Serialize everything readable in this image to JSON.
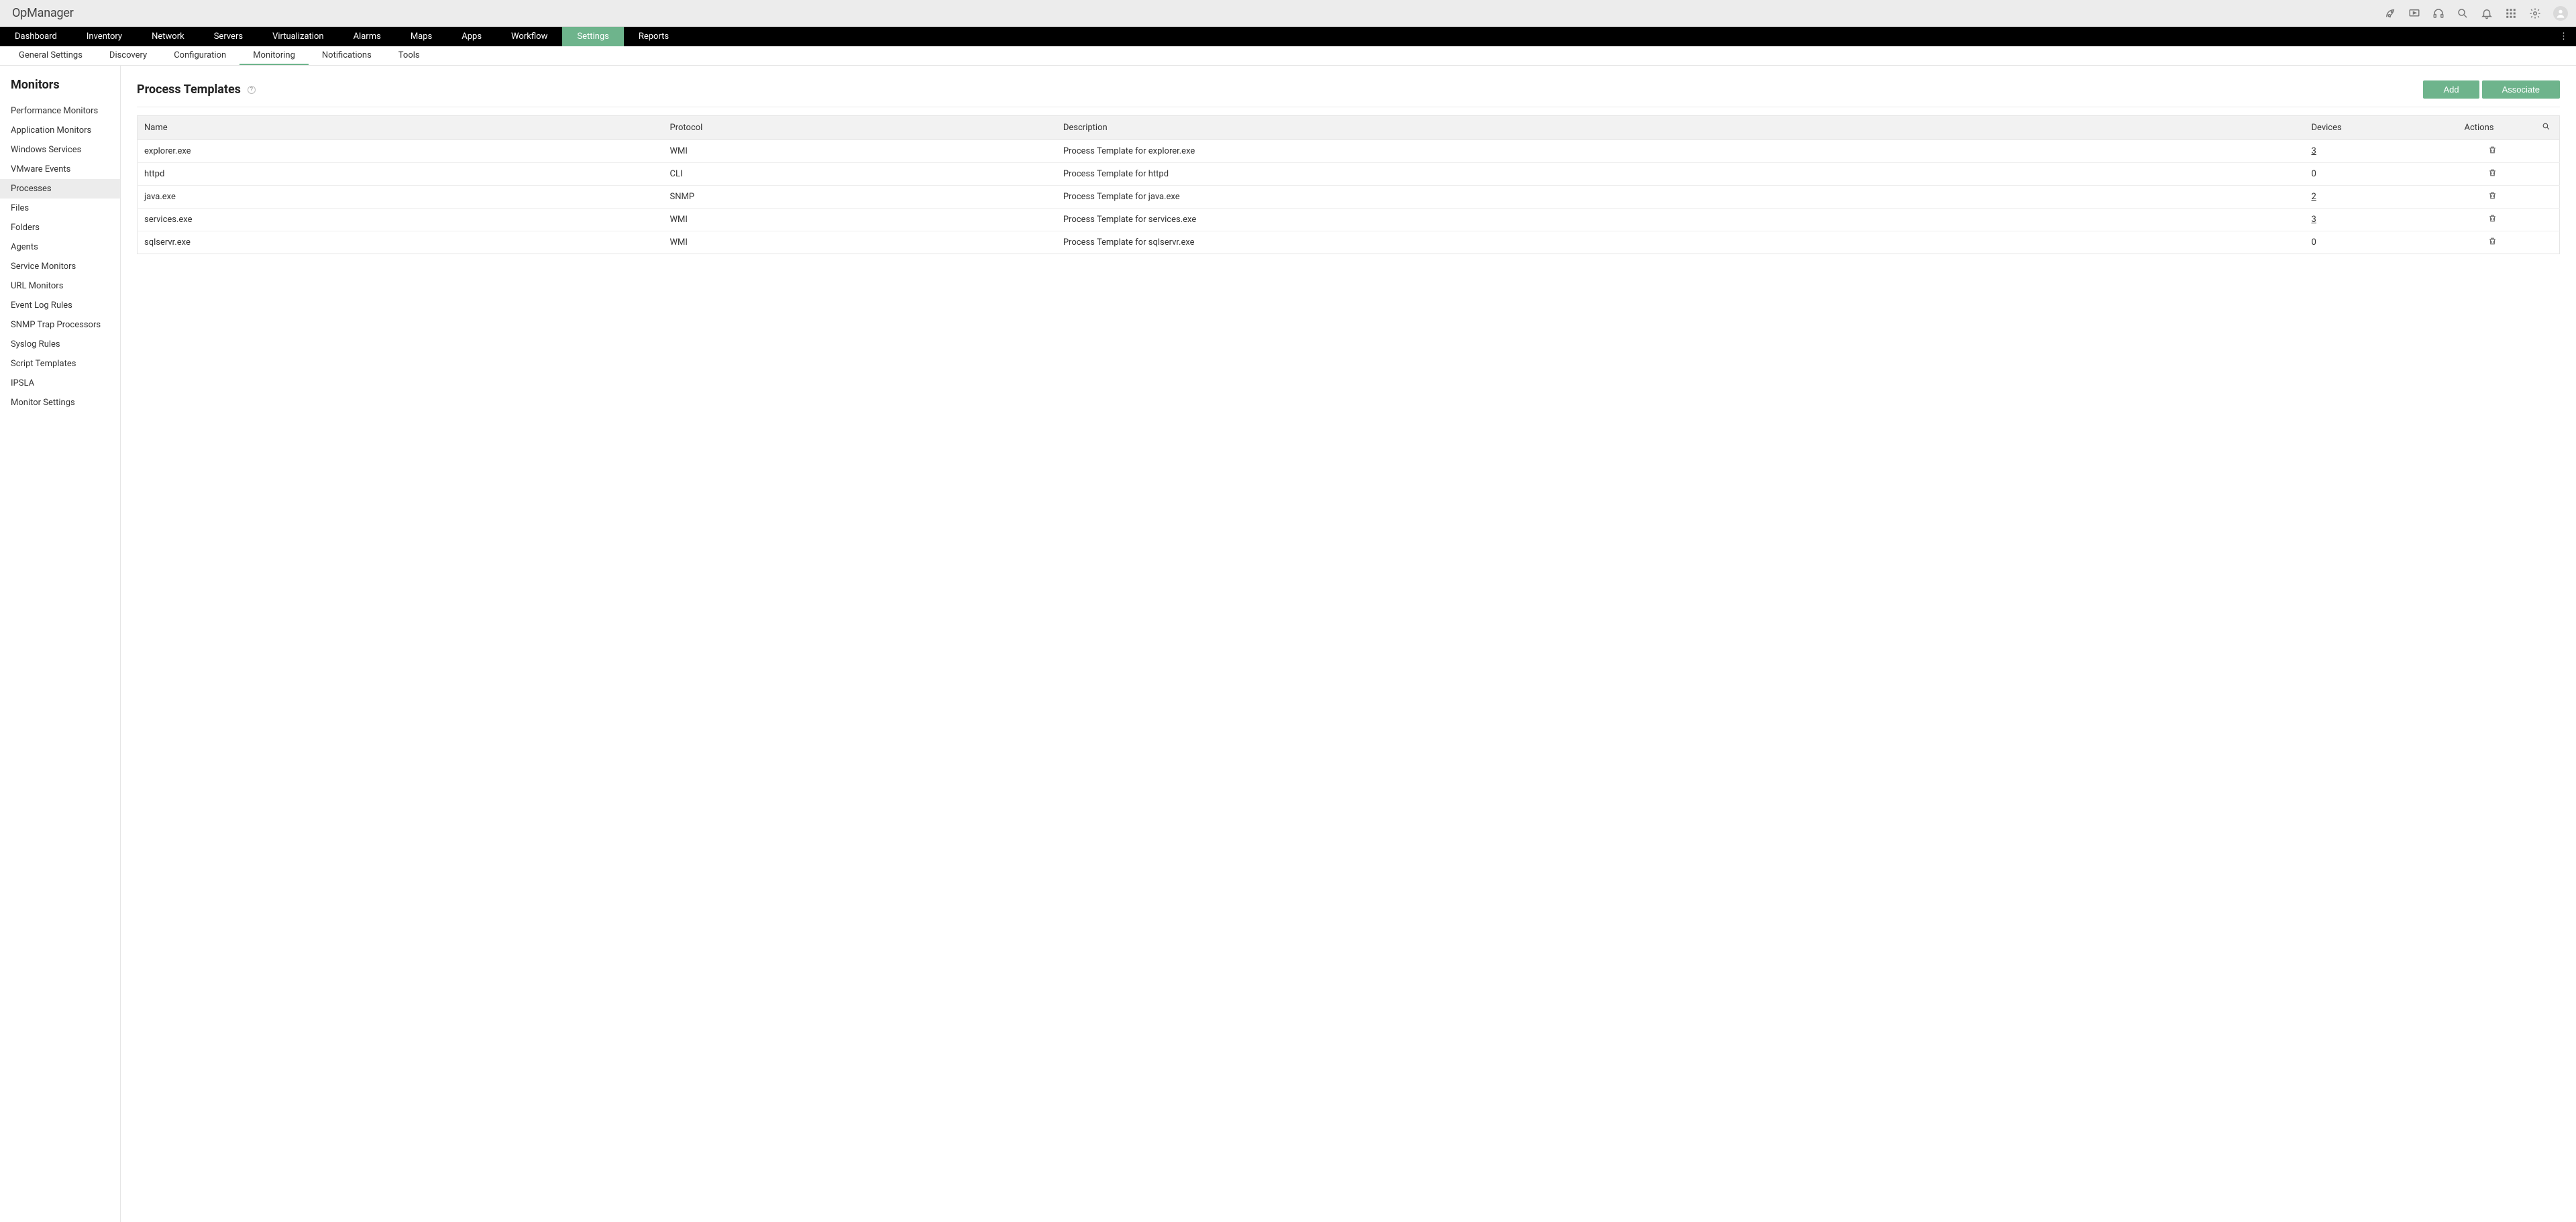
{
  "app": {
    "name": "OpManager"
  },
  "mainNav": {
    "items": [
      {
        "label": "Dashboard",
        "active": false
      },
      {
        "label": "Inventory",
        "active": false
      },
      {
        "label": "Network",
        "active": false
      },
      {
        "label": "Servers",
        "active": false
      },
      {
        "label": "Virtualization",
        "active": false
      },
      {
        "label": "Alarms",
        "active": false
      },
      {
        "label": "Maps",
        "active": false
      },
      {
        "label": "Apps",
        "active": false
      },
      {
        "label": "Workflow",
        "active": false
      },
      {
        "label": "Settings",
        "active": true
      },
      {
        "label": "Reports",
        "active": false
      }
    ]
  },
  "subNav": {
    "items": [
      {
        "label": "General Settings",
        "active": false
      },
      {
        "label": "Discovery",
        "active": false
      },
      {
        "label": "Configuration",
        "active": false
      },
      {
        "label": "Monitoring",
        "active": true
      },
      {
        "label": "Notifications",
        "active": false
      },
      {
        "label": "Tools",
        "active": false
      }
    ]
  },
  "sidebar": {
    "title": "Monitors",
    "items": [
      {
        "label": "Performance Monitors",
        "active": false
      },
      {
        "label": "Application Monitors",
        "active": false
      },
      {
        "label": "Windows Services",
        "active": false
      },
      {
        "label": "VMware Events",
        "active": false
      },
      {
        "label": "Processes",
        "active": true
      },
      {
        "label": "Files",
        "active": false
      },
      {
        "label": "Folders",
        "active": false
      },
      {
        "label": "Agents",
        "active": false
      },
      {
        "label": "Service Monitors",
        "active": false
      },
      {
        "label": "URL Monitors",
        "active": false
      },
      {
        "label": "Event Log Rules",
        "active": false
      },
      {
        "label": "SNMP Trap Processors",
        "active": false
      },
      {
        "label": "Syslog Rules",
        "active": false
      },
      {
        "label": "Script Templates",
        "active": false
      },
      {
        "label": "IPSLA",
        "active": false
      },
      {
        "label": "Monitor Settings",
        "active": false
      }
    ]
  },
  "page": {
    "title": "Process Templates",
    "help": "?",
    "buttons": {
      "add": "Add",
      "associate": "Associate"
    }
  },
  "table": {
    "columns": {
      "name": "Name",
      "protocol": "Protocol",
      "description": "Description",
      "devices": "Devices",
      "actions": "Actions"
    },
    "rows": [
      {
        "name": "explorer.exe",
        "protocol": "WMI",
        "description": "Process Template for explorer.exe",
        "devices": "3",
        "devicesLink": true
      },
      {
        "name": "httpd",
        "protocol": "CLI",
        "description": "Process Template for httpd",
        "devices": "0",
        "devicesLink": false
      },
      {
        "name": "java.exe",
        "protocol": "SNMP",
        "description": "Process Template for java.exe",
        "devices": "2",
        "devicesLink": true
      },
      {
        "name": "services.exe",
        "protocol": "WMI",
        "description": "Process Template for services.exe",
        "devices": "3",
        "devicesLink": true
      },
      {
        "name": "sqlservr.exe",
        "protocol": "WMI",
        "description": "Process Template for sqlservr.exe",
        "devices": "0",
        "devicesLink": false
      }
    ]
  }
}
